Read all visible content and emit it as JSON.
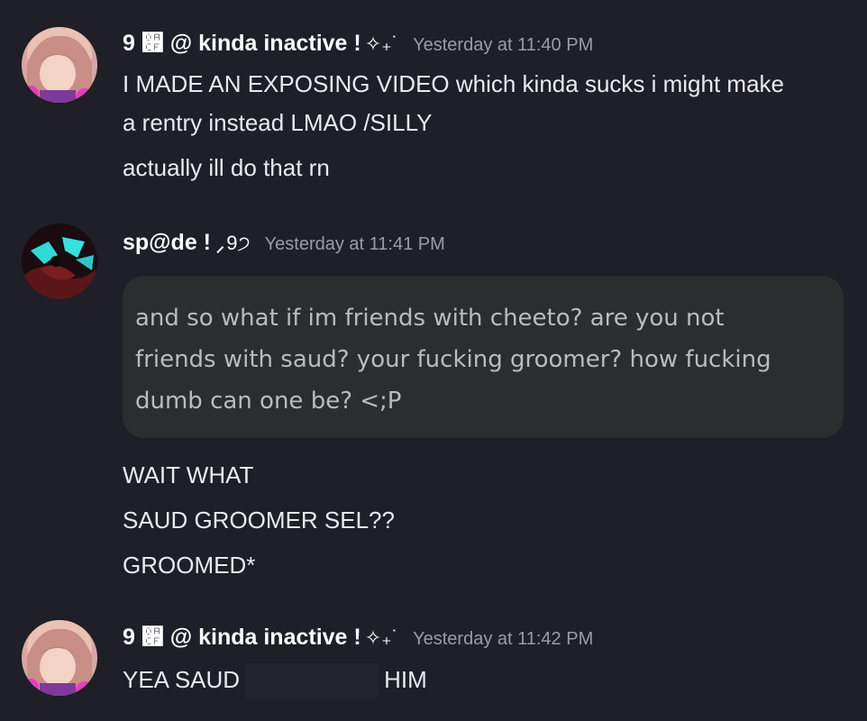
{
  "messages": [
    {
      "username": "9 ૏ @ kinda inactive !",
      "deco": "✧₊˙",
      "timestamp": "Yesterday at 11:40 PM",
      "lines": [
        "I MADE AN EXPOSING VIDEO which kinda sucks i might make",
        "a rentry instead LMAO /SILLY",
        "actually ill do that rn"
      ]
    },
    {
      "username": "sp@de !",
      "deco": "⸝9੭",
      "timestamp": "Yesterday at 11:41 PM",
      "embed_lines": [
        "and so what if im friends with cheeto? are you not",
        "friends with saud? your fucking groomer? how fucking",
        "dumb can one be? <;P"
      ],
      "lines": [
        "WAIT WHAT",
        "SAUD GROOMER SEL??",
        "GROOMED*"
      ]
    },
    {
      "username": "9 ૏ @ kinda inactive !",
      "deco": "✧₊˙",
      "timestamp": "Yesterday at 11:42 PM",
      "line_before": "YEA SAUD",
      "line_after": "HIM"
    }
  ]
}
